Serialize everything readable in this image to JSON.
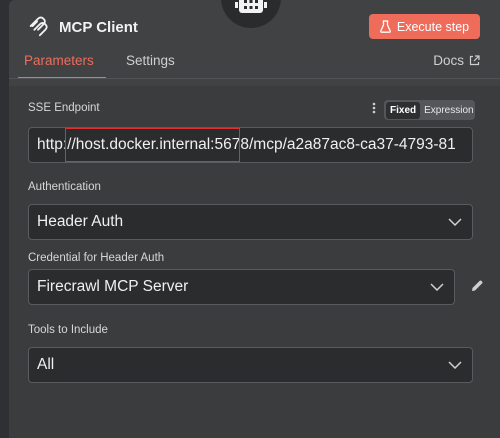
{
  "header": {
    "title": "MCP Client",
    "execute_label": "Execute step",
    "icons": {
      "node": "robot-icon",
      "title": "mcp-logo-icon",
      "execute": "flask-icon",
      "docs": "external-link-icon"
    }
  },
  "tabs": [
    {
      "label": "Parameters",
      "active": true
    },
    {
      "label": "Settings",
      "active": false
    }
  ],
  "docs_label": "Docs",
  "fields": {
    "sse_endpoint": {
      "label": "SSE Endpoint",
      "value": "http://host.docker.internal:5678/mcp/a2a87ac8-ca37-4793-81",
      "mode_fixed": "Fixed",
      "mode_expression": "Expression"
    },
    "authentication": {
      "label": "Authentication",
      "value": "Header Auth"
    },
    "credential": {
      "label": "Credential for Header Auth",
      "value": "Firecrawl  MCP Server"
    },
    "tools": {
      "label": "Tools to Include",
      "value": "All"
    }
  },
  "colors": {
    "accent": "#ef6c5a",
    "panel": "#414244",
    "field_bg": "#2b2c2e"
  }
}
